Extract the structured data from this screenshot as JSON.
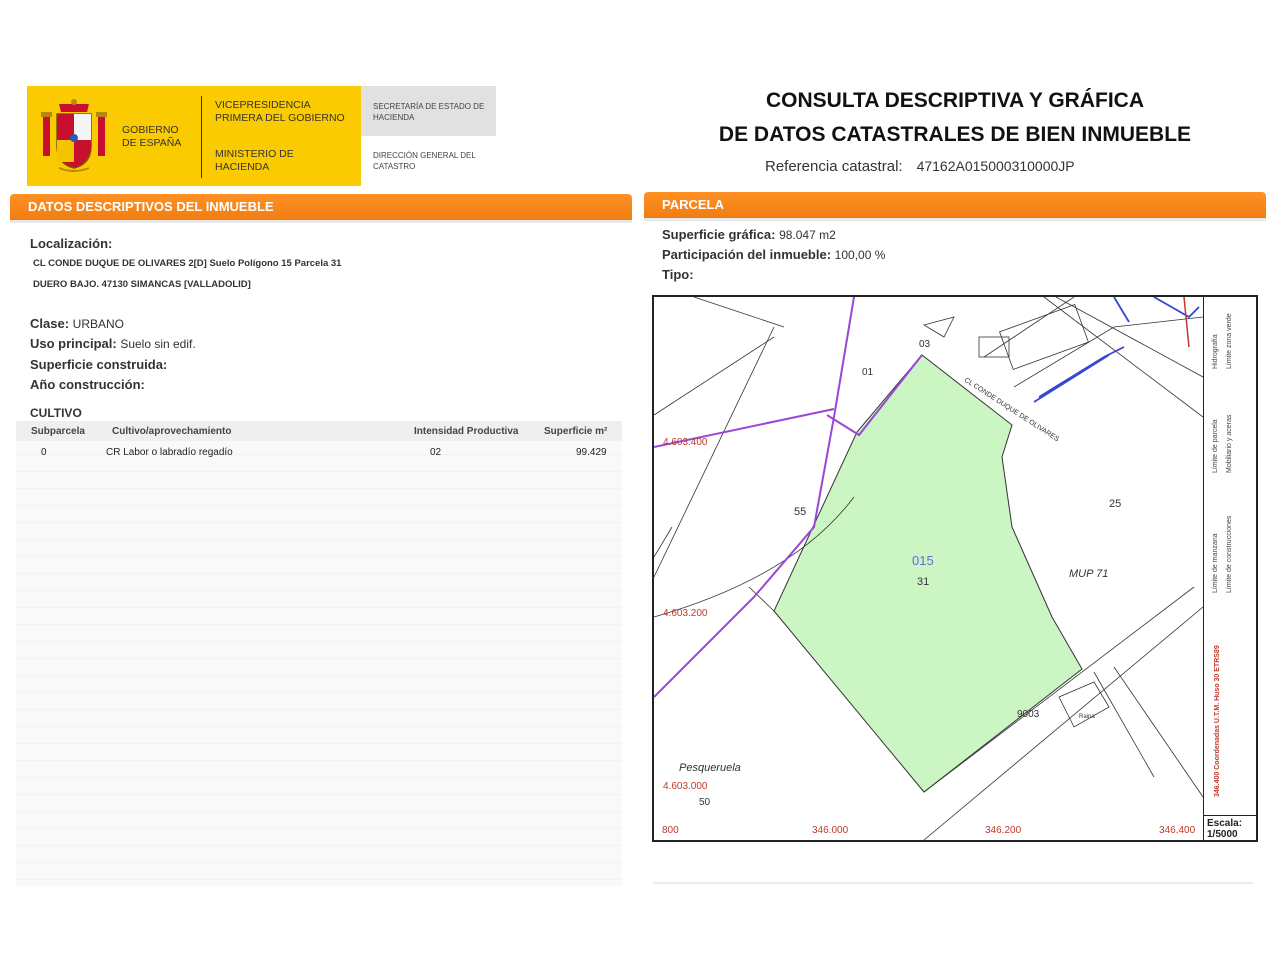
{
  "logo": {
    "gobierno": "GOBIERNO DE ESPAÑA",
    "vicepresidencia": "VICEPRESIDENCIA PRIMERA DEL GOBIERNO",
    "ministerio": "MINISTERIO DE HACIENDA",
    "secretaria": "SECRETARÍA DE ESTADO DE HACIENDA",
    "direccion": "DIRECCIÓN GENERAL DEL CATASTRO"
  },
  "header": {
    "title_line1": "CONSULTA DESCRIPTIVA Y GRÁFICA",
    "title_line2": "DE DATOS CATASTRALES DE BIEN INMUEBLE",
    "ref_label": "Referencia catastral:",
    "ref_value": "47162A015000310000JP"
  },
  "descriptivos": {
    "bar": "DATOS DESCRIPTIVOS DEL INMUEBLE",
    "localizacion_label": "Localización:",
    "localizacion_line1": "CL CONDE DUQUE DE OLIVARES 2[D] Suelo Polígono 15 Parcela 31",
    "localizacion_line2": "DUERO BAJO. 47130 SIMANCAS [VALLADOLID]",
    "clase_label": "Clase:",
    "clase_value": "URBANO",
    "uso_label": "Uso principal:",
    "uso_value": "Suelo sin edif.",
    "sup_label": "Superficie construida:",
    "anio_label": "Año construcción:"
  },
  "cultivo": {
    "title": "CULTIVO",
    "headers": [
      "Subparcela",
      "Cultivo/aprovechamiento",
      "Intensidad Productiva",
      "Superficie m²"
    ],
    "rows": [
      [
        "0",
        "CR Labor o labradío regadío",
        "02",
        "99.429"
      ]
    ]
  },
  "parcela": {
    "bar": "PARCELA",
    "sup_label": "Superficie gráfica:",
    "sup_value": "98.047 m2",
    "part_label": "Participación del inmueble:",
    "part_value": "100,00 %",
    "tipo_label": "Tipo:"
  },
  "map": {
    "labels": {
      "poligono": "015",
      "parcela": "31",
      "p01": "01",
      "p03": "03",
      "p55": "55",
      "p25": "25",
      "mup": "MUP 71",
      "p9003": "9003",
      "raina": "Raina",
      "pesqueruela": "Pesqueruela",
      "p50": "50",
      "street": "CL CONDE DUQUE DE OLIVARES"
    },
    "y_coords": [
      "4.603.400",
      "4.603.200",
      "4.603.000"
    ],
    "x_coords": [
      "800",
      "346.000",
      "346.200",
      "346.400"
    ],
    "scale_label": "Escala:",
    "scale_value": "1/5000",
    "legend": {
      "hidrografia": "Hidrografía",
      "zona_verde": "Límite zona verde",
      "parcela": "Límite de parcela",
      "mobiliario": "Mobiliario y aceras",
      "manzana": "Límite de manzana",
      "construcciones": "Límite de construcciones",
      "coords": "346.400 Coordenadas U.T.M. Huso 30 ETRS89"
    },
    "colors": {
      "parcel_fill": "#ccf5c4",
      "parcel_stroke": "#333333",
      "zone_line": "#9b46d6",
      "water": "#3347d6",
      "coords": "#c0392b"
    }
  }
}
